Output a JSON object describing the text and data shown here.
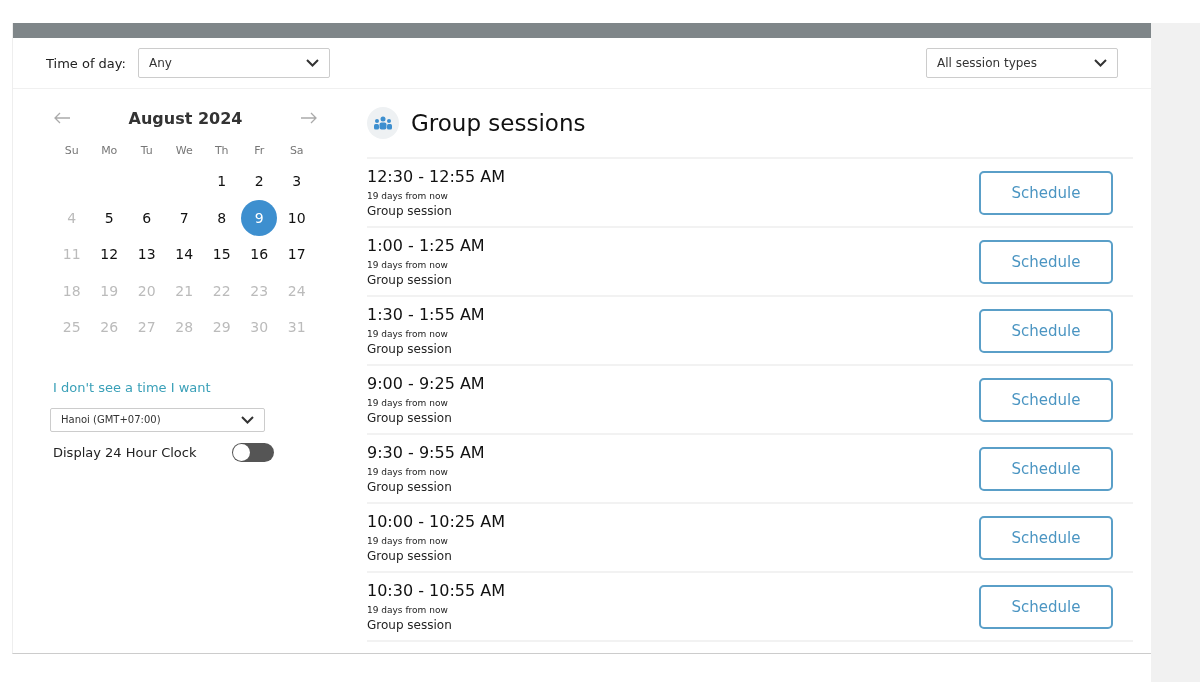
{
  "filters": {
    "time_of_day": {
      "label": "Time of day:",
      "value": "Any"
    },
    "session_type": {
      "value": "All session types"
    }
  },
  "calendar": {
    "month": "August 2024",
    "weekdays": [
      "Su",
      "Mo",
      "Tu",
      "We",
      "Th",
      "Fr",
      "Sa"
    ],
    "weeks": [
      [
        {
          "label": "1",
          "disabled": false,
          "selected": false
        },
        {
          "label": "2",
          "disabled": false,
          "selected": false
        },
        {
          "label": "3",
          "disabled": false,
          "selected": false
        }
      ],
      [
        {
          "label": "4",
          "disabled": true,
          "selected": false
        },
        {
          "label": "5",
          "disabled": false,
          "selected": false
        },
        {
          "label": "6",
          "disabled": false,
          "selected": false
        },
        {
          "label": "7",
          "disabled": false,
          "selected": false
        },
        {
          "label": "8",
          "disabled": false,
          "selected": false
        },
        {
          "label": "9",
          "disabled": false,
          "selected": true
        },
        {
          "label": "10",
          "disabled": false,
          "selected": false
        }
      ],
      [
        {
          "label": "11",
          "disabled": true,
          "selected": false
        },
        {
          "label": "12",
          "disabled": false,
          "selected": false
        },
        {
          "label": "13",
          "disabled": false,
          "selected": false
        },
        {
          "label": "14",
          "disabled": false,
          "selected": false
        },
        {
          "label": "15",
          "disabled": false,
          "selected": false
        },
        {
          "label": "16",
          "disabled": false,
          "selected": false
        },
        {
          "label": "17",
          "disabled": false,
          "selected": false
        }
      ],
      [
        {
          "label": "18",
          "disabled": true,
          "selected": false
        },
        {
          "label": "19",
          "disabled": true,
          "selected": false
        },
        {
          "label": "20",
          "disabled": true,
          "selected": false
        },
        {
          "label": "21",
          "disabled": true,
          "selected": false
        },
        {
          "label": "22",
          "disabled": true,
          "selected": false
        },
        {
          "label": "23",
          "disabled": true,
          "selected": false
        },
        {
          "label": "24",
          "disabled": true,
          "selected": false
        }
      ],
      [
        {
          "label": "25",
          "disabled": true,
          "selected": false
        },
        {
          "label": "26",
          "disabled": true,
          "selected": false
        },
        {
          "label": "27",
          "disabled": true,
          "selected": false
        },
        {
          "label": "28",
          "disabled": true,
          "selected": false
        },
        {
          "label": "29",
          "disabled": true,
          "selected": false
        },
        {
          "label": "30",
          "disabled": true,
          "selected": false
        },
        {
          "label": "31",
          "disabled": true,
          "selected": false
        }
      ]
    ]
  },
  "no_time_link": "I don't see a time I want",
  "timezone": {
    "value": "Hanoi (GMT+07:00)"
  },
  "clock_toggle": {
    "label": "Display 24 Hour Clock",
    "on": false
  },
  "sessions_title": "Group sessions",
  "sessions": [
    {
      "time": "12:30 - 12:55 AM",
      "relative": "19 days from now",
      "type": "Group session",
      "action": "Schedule"
    },
    {
      "time": "1:00 - 1:25 AM",
      "relative": "19 days from now",
      "type": "Group session",
      "action": "Schedule"
    },
    {
      "time": "1:30 - 1:55 AM",
      "relative": "19 days from now",
      "type": "Group session",
      "action": "Schedule"
    },
    {
      "time": "9:00 - 9:25 AM",
      "relative": "19 days from now",
      "type": "Group session",
      "action": "Schedule"
    },
    {
      "time": "9:30 - 9:55 AM",
      "relative": "19 days from now",
      "type": "Group session",
      "action": "Schedule"
    },
    {
      "time": "10:00 - 10:25 AM",
      "relative": "19 days from now",
      "type": "Group session",
      "action": "Schedule"
    },
    {
      "time": "10:30 - 10:55 AM",
      "relative": "19 days from now",
      "type": "Group session",
      "action": "Schedule"
    }
  ]
}
